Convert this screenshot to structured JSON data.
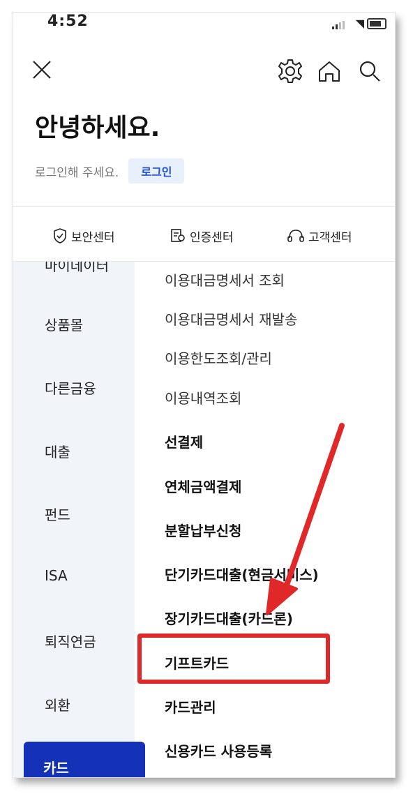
{
  "status_bar": {
    "time": "4:52"
  },
  "header": {
    "greeting": "안녕하세요.",
    "login_hint": "로그인해 주세요.",
    "login_button": "로그인"
  },
  "quick_links": [
    {
      "label": "보안센터",
      "icon": "shield-check-icon"
    },
    {
      "label": "인증센터",
      "icon": "certificate-icon"
    },
    {
      "label": "고객센터",
      "icon": "headset-icon"
    }
  ],
  "sidebar": {
    "partial_top": "마이데이터",
    "items": [
      "상품몰",
      "다른금융",
      "대출",
      "펀드",
      "ISA",
      "퇴직연금",
      "외환"
    ],
    "active": "카드"
  },
  "submenu": {
    "items": [
      "이용대금명세서 조회",
      "이용대금명세서 재발송",
      "이용한도조회/관리",
      "이용내역조회"
    ],
    "bold_items": [
      "선결제",
      "연체금액결제",
      "분할납부신청",
      "단기카드대출(현금서비스)",
      "장기카드대출(카드론)",
      "기프트카드",
      "카드관리",
      "신용카드 사용등록"
    ]
  },
  "annotation": {
    "highlight_color": "#e02828",
    "highlighted_item": "기프트카드"
  },
  "colors": {
    "accent": "#1432b8",
    "login_bg": "#e8f0fb",
    "login_text": "#1e4fd6",
    "sidebar_bg": "#f1f4f9"
  }
}
